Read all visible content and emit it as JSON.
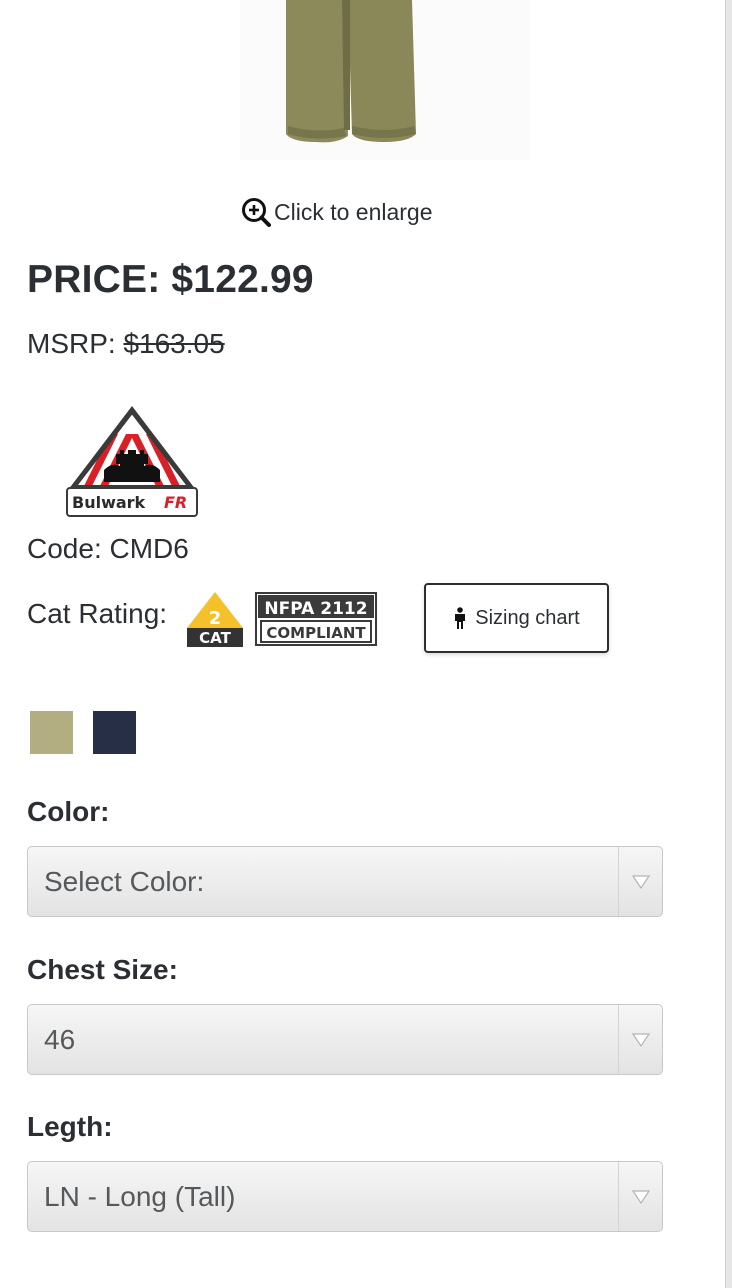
{
  "image": {
    "icon": "product-pants-image"
  },
  "enlarge": {
    "label": "Click to enlarge",
    "icon": "zoom-in-icon"
  },
  "price": {
    "text": "PRICE: $122.99"
  },
  "msrp": {
    "label": "MSRP: ",
    "value": "$163.05"
  },
  "brand": {
    "name": "Bulwark",
    "suffix": "FR"
  },
  "code": {
    "text": "Code: CMD6"
  },
  "cat": {
    "label": "Cat Rating:",
    "level": "2",
    "level_text": "CAT",
    "nfpa_line1": "NFPA 2112",
    "nfpa_line2": "COMPLIANT"
  },
  "sizing": {
    "label": "Sizing chart",
    "icon": "person-icon"
  },
  "swatches": [
    {
      "name": "khaki",
      "color": "#b3ad82"
    },
    {
      "name": "navy",
      "color": "#272f47"
    }
  ],
  "color_field": {
    "label": "Color:",
    "value": "Select Color:"
  },
  "chest_field": {
    "label": "Chest Size:",
    "value": "46"
  },
  "length_field": {
    "label": "Legth:",
    "value": "LN - Long (Tall)"
  },
  "colors": {
    "text": "#2b2f33",
    "pants": "#8c8a5a",
    "brand_red": "#d92027",
    "cat_yellow": "#f4c12b",
    "badge_dark": "#3a3a3a"
  }
}
